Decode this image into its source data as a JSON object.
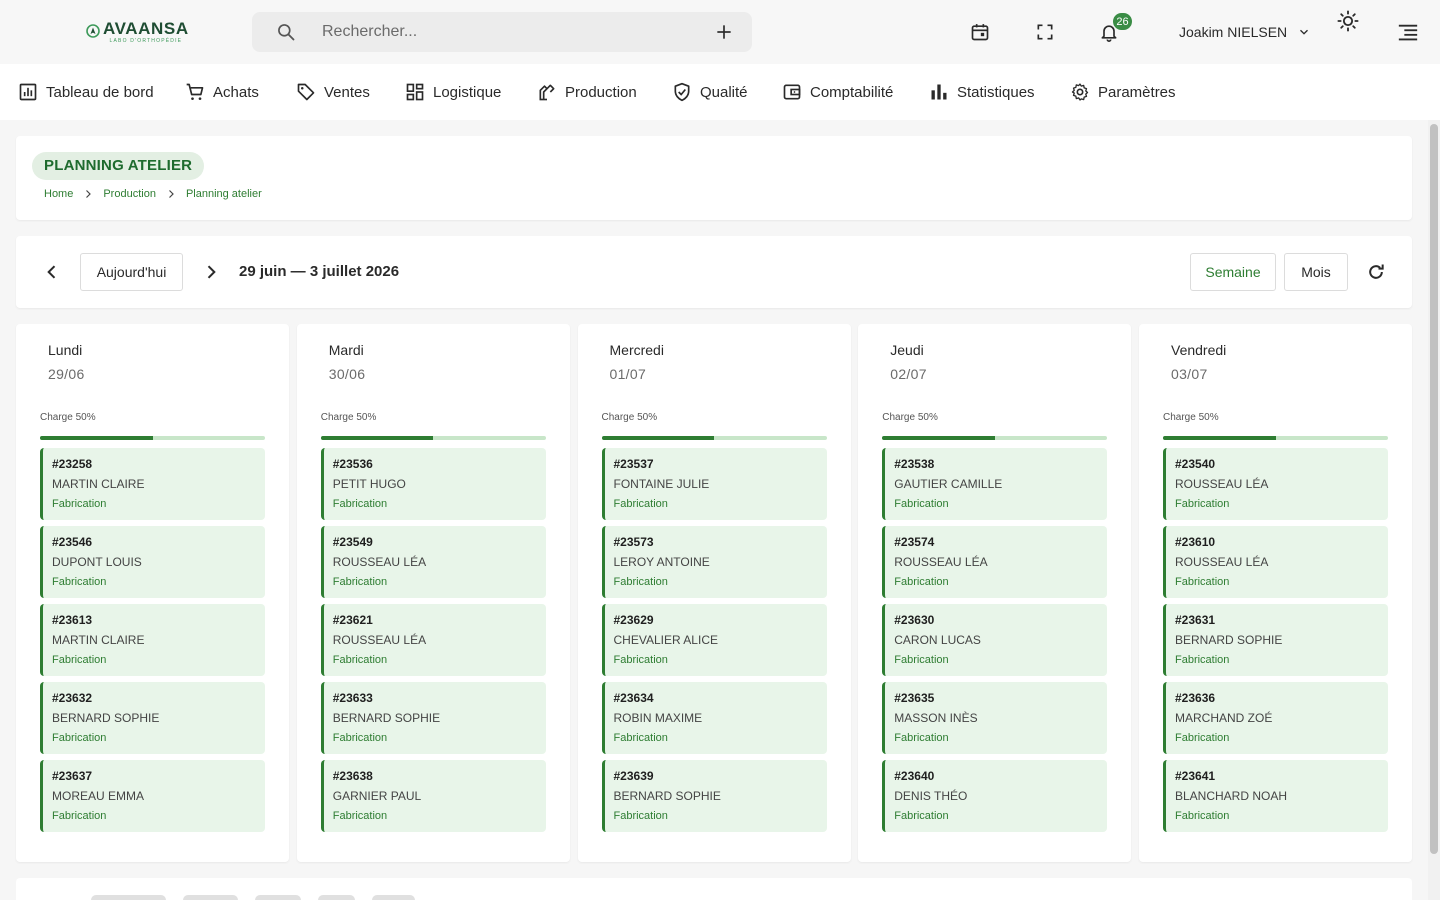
{
  "brand": {
    "name": "AVAANSA",
    "tagline": "LABO D'ORTHOPÉDIE",
    "color": "#1f4d33",
    "accent": "#2e7d32"
  },
  "topbar": {
    "search_placeholder": "Rechercher...",
    "notification_count": "26",
    "user_name": "Joakim NIELSEN",
    "icons": [
      "search-icon",
      "add-icon",
      "calendar-icon",
      "fullscreen-icon",
      "bell-icon",
      "chevron-down-icon",
      "sun-icon",
      "menu-icon"
    ]
  },
  "menu": [
    {
      "label": "Tableau de bord",
      "icon": "dashboard-icon"
    },
    {
      "label": "Achats",
      "icon": "cart-icon"
    },
    {
      "label": "Ventes",
      "icon": "tag-icon"
    },
    {
      "label": "Logistique",
      "icon": "grid-icon"
    },
    {
      "label": "Production",
      "icon": "tool-icon"
    },
    {
      "label": "Qualité",
      "icon": "shield-check-icon"
    },
    {
      "label": "Comptabilité",
      "icon": "wallet-icon"
    },
    {
      "label": "Statistiques",
      "icon": "bar-chart-icon"
    },
    {
      "label": "Paramètres",
      "icon": "gear-icon"
    }
  ],
  "page": {
    "title": "PLANNING ATELIER",
    "breadcrumb": [
      "Home",
      "Production",
      "Planning atelier"
    ]
  },
  "toolbar": {
    "today_label": "Aujourd'hui",
    "range_label": "29 juin — 3 juillet 2026",
    "week_label": "Semaine",
    "month_label": "Mois",
    "active_view": "Semaine"
  },
  "days": [
    {
      "name": "Lundi",
      "date": "29/06",
      "charge_label": "Charge 50%",
      "charge": 0.5,
      "jobs": [
        {
          "id": "#23258",
          "patient": "MARTIN CLAIRE",
          "type": "Fabrication"
        },
        {
          "id": "#23546",
          "patient": "DUPONT LOUIS",
          "type": "Fabrication"
        },
        {
          "id": "#23613",
          "patient": "MARTIN CLAIRE",
          "type": "Fabrication"
        },
        {
          "id": "#23632",
          "patient": "BERNARD SOPHIE",
          "type": "Fabrication"
        },
        {
          "id": "#23637",
          "patient": "MOREAU EMMA",
          "type": "Fabrication"
        }
      ]
    },
    {
      "name": "Mardi",
      "date": "30/06",
      "charge_label": "Charge 50%",
      "charge": 0.5,
      "jobs": [
        {
          "id": "#23536",
          "patient": "PETIT HUGO",
          "type": "Fabrication"
        },
        {
          "id": "#23549",
          "patient": "ROUSSEAU LÉA",
          "type": "Fabrication"
        },
        {
          "id": "#23621",
          "patient": "ROUSSEAU LÉA",
          "type": "Fabrication"
        },
        {
          "id": "#23633",
          "patient": "BERNARD SOPHIE",
          "type": "Fabrication"
        },
        {
          "id": "#23638",
          "patient": "GARNIER PAUL",
          "type": "Fabrication"
        }
      ]
    },
    {
      "name": "Mercredi",
      "date": "01/07",
      "charge_label": "Charge 50%",
      "charge": 0.5,
      "jobs": [
        {
          "id": "#23537",
          "patient": "FONTAINE JULIE",
          "type": "Fabrication"
        },
        {
          "id": "#23573",
          "patient": "LEROY ANTOINE",
          "type": "Fabrication"
        },
        {
          "id": "#23629",
          "patient": "CHEVALIER ALICE",
          "type": "Fabrication"
        },
        {
          "id": "#23634",
          "patient": "ROBIN MAXIME",
          "type": "Fabrication"
        },
        {
          "id": "#23639",
          "patient": "BERNARD SOPHIE",
          "type": "Fabrication"
        }
      ]
    },
    {
      "name": "Jeudi",
      "date": "02/07",
      "charge_label": "Charge 50%",
      "charge": 0.5,
      "jobs": [
        {
          "id": "#23538",
          "patient": "GAUTIER CAMILLE",
          "type": "Fabrication"
        },
        {
          "id": "#23574",
          "patient": "ROUSSEAU LÉA",
          "type": "Fabrication"
        },
        {
          "id": "#23630",
          "patient": "CARON LUCAS",
          "type": "Fabrication"
        },
        {
          "id": "#23635",
          "patient": "MASSON INÈS",
          "type": "Fabrication"
        },
        {
          "id": "#23640",
          "patient": "DENIS THÉO",
          "type": "Fabrication"
        }
      ]
    },
    {
      "name": "Vendredi",
      "date": "03/07",
      "charge_label": "Charge 50%",
      "charge": 0.5,
      "jobs": [
        {
          "id": "#23540",
          "patient": "ROUSSEAU LÉA",
          "type": "Fabrication"
        },
        {
          "id": "#23610",
          "patient": "ROUSSEAU LÉA",
          "type": "Fabrication"
        },
        {
          "id": "#23631",
          "patient": "BERNARD SOPHIE",
          "type": "Fabrication"
        },
        {
          "id": "#23636",
          "patient": "MARCHAND ZOÉ",
          "type": "Fabrication"
        },
        {
          "id": "#23641",
          "patient": "BLANCHARD NOAH",
          "type": "Fabrication"
        }
      ]
    }
  ]
}
